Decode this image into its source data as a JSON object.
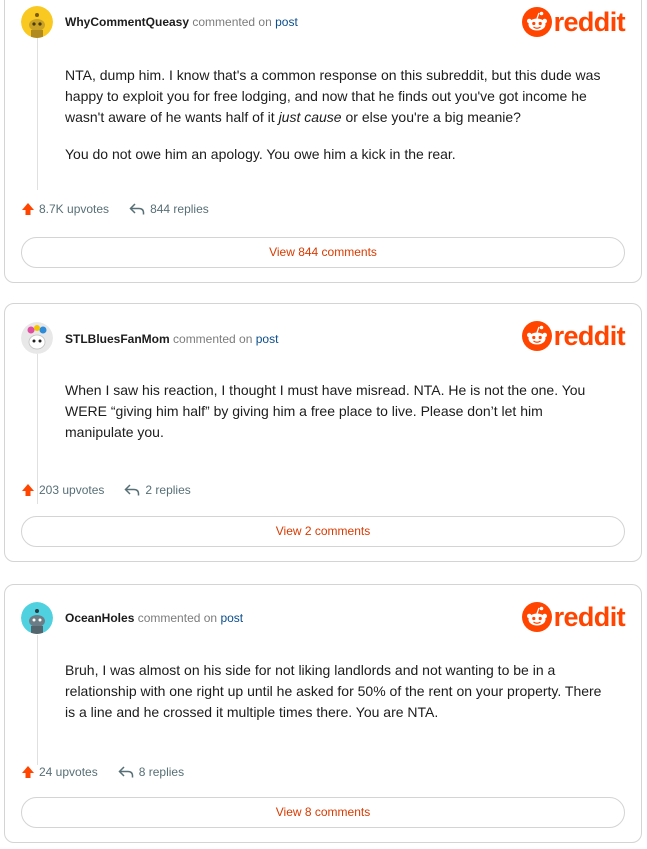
{
  "brand": {
    "logo_text": "reddit",
    "accent": "#ff4500",
    "icon": "reddit-snoo-icon"
  },
  "comments": [
    {
      "username": "WhyCommentQueasy",
      "action": "commented on",
      "post_link": "post",
      "avatar_color": "#f9c922",
      "body_parts": [
        "NTA, dump him. I know that's a common response on this subreddit, but this dude was happy to exploit you for free lodging, and now that he finds out you've got income he wasn't aware of he wants half of it ",
        "just cause",
        " or else you're a big meanie?"
      ],
      "body_p2": "You do not owe him an apology. You owe him a kick in the rear.",
      "upvotes": "8.7K upvotes",
      "replies": "844 replies",
      "view_label": "View 844 comments"
    },
    {
      "username": "STLBluesFanMom",
      "action": "commented on",
      "post_link": "post",
      "avatar_color": "#e8e8e8",
      "body": "When I saw his reaction, I thought I must have misread. NTA. He is not the one. You WERE “giving him half” by giving him a free place to live. Please don’t let him manipulate you.",
      "upvotes": "203 upvotes",
      "replies": "2 replies",
      "view_label": "View 2 comments"
    },
    {
      "username": "OceanHoles",
      "action": "commented on",
      "post_link": "post",
      "avatar_color": "#4fd1e0",
      "body": "Bruh, I was almost on his side for not liking landlords and not wanting to be in a relationship with one right up until he asked for 50% of the rent on your property. There is a line and he crossed it multiple times there. You are NTA.",
      "upvotes": "24 upvotes",
      "replies": "8 replies",
      "view_label": "View 8 comments"
    }
  ]
}
